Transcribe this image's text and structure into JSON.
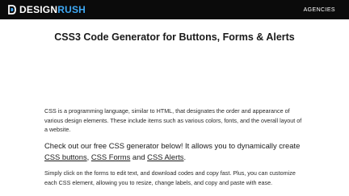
{
  "header": {
    "logo_primary": "DESIGN",
    "logo_accent": "RUSH",
    "nav_agencies": "AGENCIES",
    "brand_color": "#3fa9f5",
    "background": "#0b0b0b",
    "logo_icon": "designrush-mark-icon"
  },
  "page": {
    "title": "CSS3 Code Generator for Buttons, Forms & Alerts",
    "intro": "CSS is a programming language, similar to HTML, that designates the order and appearance of various design elements. These include items such as various colors, fonts, and the overall layout of a website.",
    "callout": {
      "before": "Check out our free CSS generator below! It allows you to dynamically create ",
      "link_buttons": "CSS buttons",
      "sep1": ", ",
      "link_forms": "CSS Forms",
      "sep2": " and ",
      "link_alerts": "CSS Alerts",
      "after": "."
    },
    "instructions": "Simply click on the forms to edit text, and download codes and copy fast. Plus, you can customize each CSS element, allowing you to resize, change labels, and copy and paste with ease."
  }
}
